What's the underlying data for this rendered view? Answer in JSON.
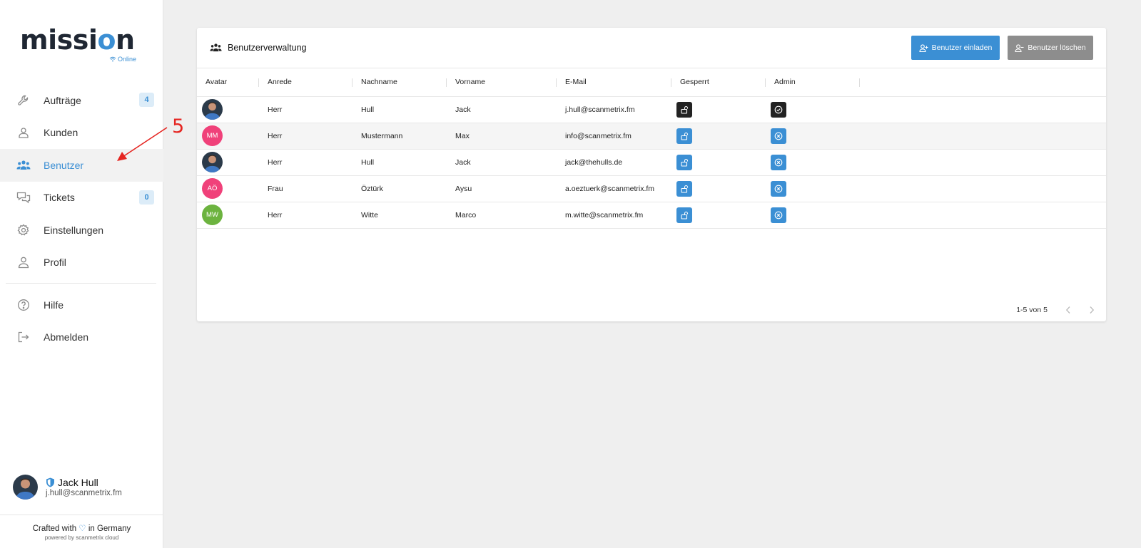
{
  "app": {
    "logo_prefix": "missi",
    "logo_o": "o",
    "logo_suffix": "n",
    "status": "Online"
  },
  "sidebar": {
    "items": [
      {
        "label": "Aufträge",
        "icon": "wrench-icon",
        "badge": "4"
      },
      {
        "label": "Kunden",
        "icon": "customer-icon"
      },
      {
        "label": "Benutzer",
        "icon": "users-icon",
        "active": true
      },
      {
        "label": "Tickets",
        "icon": "chat-icon",
        "badge": "0"
      },
      {
        "label": "Einstellungen",
        "icon": "gear-icon"
      },
      {
        "label": "Profil",
        "icon": "person-icon"
      }
    ],
    "bottom_items": [
      {
        "label": "Hilfe",
        "icon": "help-icon"
      },
      {
        "label": "Abmelden",
        "icon": "logout-icon"
      }
    ],
    "user": {
      "name": "Jack Hull",
      "email": "j.hull@scanmetrix.fm"
    },
    "footer": {
      "crafted_prefix": "Crafted with",
      "heart": "♡",
      "crafted_suffix": "in Germany",
      "powered": "powered by scanmetrix cloud"
    }
  },
  "annotation": {
    "number": "5",
    "color": "#e52521"
  },
  "panel": {
    "title": "Benutzerverwaltung",
    "invite_label": "Benutzer einladen",
    "delete_label": "Benutzer löschen",
    "columns": [
      "Avatar",
      "Anrede",
      "Nachname",
      "Vorname",
      "E-Mail",
      "Gesperrt",
      "Admin"
    ],
    "rows": [
      {
        "avatar_type": "photo",
        "initials": "",
        "avatar_color": "",
        "anrede": "Herr",
        "nachname": "Hull",
        "vorname": "Jack",
        "email": "j.hull@scanmetrix.fm",
        "gesperrt_style": "dark",
        "admin_style": "dark",
        "admin_icon": "check-circle-icon"
      },
      {
        "avatar_type": "initials",
        "initials": "MM",
        "avatar_color": "#f0417a",
        "anrede": "Herr",
        "nachname": "Mustermann",
        "vorname": "Max",
        "email": "info@scanmetrix.fm",
        "gesperrt_style": "blue",
        "admin_style": "blue",
        "admin_icon": "x-circle-icon",
        "highlight": true
      },
      {
        "avatar_type": "photo",
        "initials": "",
        "avatar_color": "",
        "anrede": "Herr",
        "nachname": "Hull",
        "vorname": "Jack",
        "email": "jack@thehulls.de",
        "gesperrt_style": "blue",
        "admin_style": "blue",
        "admin_icon": "x-circle-icon"
      },
      {
        "avatar_type": "initials",
        "initials": "AÖ",
        "avatar_color": "#f0417a",
        "anrede": "Frau",
        "nachname": "Öztürk",
        "vorname": "Aysu",
        "email": "a.oeztuerk@scanmetrix.fm",
        "gesperrt_style": "blue",
        "admin_style": "blue",
        "admin_icon": "x-circle-icon"
      },
      {
        "avatar_type": "initials",
        "initials": "MW",
        "avatar_color": "#6cb33f",
        "anrede": "Herr",
        "nachname": "Witte",
        "vorname": "Marco",
        "email": "m.witte@scanmetrix.fm",
        "gesperrt_style": "blue",
        "admin_style": "blue",
        "admin_icon": "x-circle-icon"
      }
    ],
    "pagination": "1-5 von 5"
  },
  "colors": {
    "accent": "#3b8fd4",
    "dark_button": "#222222",
    "grey_button": "#8d8d8d"
  }
}
